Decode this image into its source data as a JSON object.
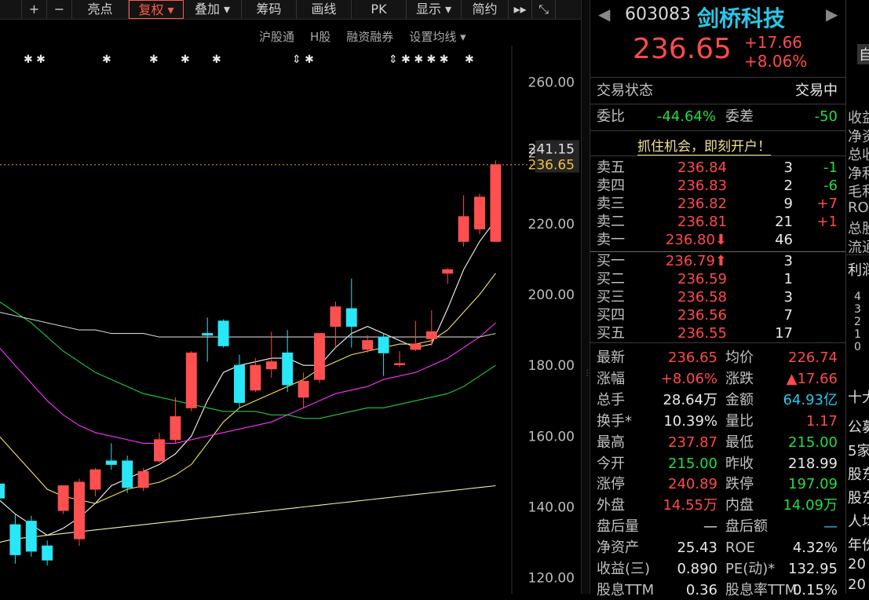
{
  "toolbar": {
    "items": [
      {
        "label": "",
        "w": 28
      },
      {
        "label": "+",
        "w": 32
      },
      {
        "label": "−",
        "w": 32
      },
      {
        "label": "亮点",
        "w": 72
      },
      {
        "label": "复权 ▾",
        "w": 70,
        "active": true
      },
      {
        "label": "叠加 ▾",
        "w": 74
      },
      {
        "label": "筹码",
        "w": 70
      },
      {
        "label": "画线",
        "w": 70
      },
      {
        "label": "PK",
        "w": 70
      },
      {
        "label": "显示 ▾",
        "w": 70
      },
      {
        "label": "简约",
        "w": 60
      },
      {
        "label": "▸▸",
        "w": 30
      },
      {
        "label": "⤡",
        "w": 30
      }
    ]
  },
  "subbar": [
    "沪股通",
    "H股",
    "融资融券",
    "设置均线 ▾"
  ],
  "chart_data": {
    "type": "candlestick",
    "ylim": [
      120,
      265
    ],
    "yticks": [
      "260.00",
      "240.00",
      "220.00",
      "200.00",
      "180.00",
      "160.00",
      "140.00",
      "120.00"
    ],
    "highlight_high": "241.15",
    "highlight_last": "236.65",
    "stars": [
      "✱ ✱",
      "✱",
      "✱",
      "✱",
      "✱",
      "⇕ ✱",
      "⇕ ✱ ✱ ✱ ✱",
      "✱"
    ],
    "candles": [
      {
        "o": 146.5,
        "h": 148.0,
        "c": 142.5,
        "l": 138.0
      },
      {
        "o": 135.0,
        "h": 138.0,
        "c": 126.5,
        "l": 124.0
      },
      {
        "o": 136.0,
        "h": 137.5,
        "c": 127.5,
        "l": 126.0
      },
      {
        "o": 129.0,
        "h": 130.5,
        "c": 125.0,
        "l": 123.5
      },
      {
        "o": 139.0,
        "h": 146.0,
        "c": 146.0,
        "l": 138.0
      },
      {
        "o": 131.0,
        "h": 148.0,
        "c": 147.0,
        "l": 129.0
      },
      {
        "o": 145.0,
        "h": 151.0,
        "c": 150.5,
        "l": 143.0
      },
      {
        "o": 153.0,
        "h": 158.0,
        "c": 152.0,
        "l": 150.5
      },
      {
        "o": 153.0,
        "h": 154.5,
        "c": 145.5,
        "l": 144.0
      },
      {
        "o": 145.5,
        "h": 151.0,
        "c": 150.0,
        "l": 144.5
      },
      {
        "o": 153.0,
        "h": 161.0,
        "c": 159.0,
        "l": 152.5
      },
      {
        "o": 159.0,
        "h": 171.0,
        "c": 165.5,
        "l": 158.0
      },
      {
        "o": 168.0,
        "h": 184.0,
        "c": 183.5,
        "l": 167.0
      },
      {
        "o": 189.0,
        "h": 193.5,
        "c": 188.5,
        "l": 181.0
      },
      {
        "o": 192.5,
        "h": 193.0,
        "c": 185.5,
        "l": 185.0
      },
      {
        "o": 180.0,
        "h": 183.0,
        "c": 169.5,
        "l": 168.0
      },
      {
        "o": 173.0,
        "h": 182.0,
        "c": 180.0,
        "l": 172.5
      },
      {
        "o": 179.0,
        "h": 189.5,
        "c": 181.0,
        "l": 176.5
      },
      {
        "o": 183.5,
        "h": 190.0,
        "c": 174.5,
        "l": 172.5
      },
      {
        "o": 171.0,
        "h": 178.0,
        "c": 175.5,
        "l": 168.0
      },
      {
        "o": 176.0,
        "h": 189.0,
        "c": 189.0,
        "l": 175.0
      },
      {
        "o": 191.0,
        "h": 198.0,
        "c": 196.5,
        "l": 185.0
      },
      {
        "o": 196.0,
        "h": 204.5,
        "c": 191.0,
        "l": 185.0
      },
      {
        "o": 184.5,
        "h": 188.5,
        "c": 187.0,
        "l": 183.5
      },
      {
        "o": 188.0,
        "h": 189.0,
        "c": 183.5,
        "l": 177.0
      },
      {
        "o": 180.5,
        "h": 184.0,
        "c": 180.5,
        "l": 179.5
      },
      {
        "o": 184.5,
        "h": 192.5,
        "c": 186.0,
        "l": 184.0
      },
      {
        "o": 187.5,
        "h": 195.5,
        "c": 189.5,
        "l": 185.5
      },
      {
        "o": 206.0,
        "h": 207.5,
        "c": 207.0,
        "l": 203.0
      },
      {
        "o": 215.0,
        "h": 228.0,
        "c": 222.0,
        "l": 213.5
      },
      {
        "o": 218.5,
        "h": 228.5,
        "c": 227.5,
        "l": 217.0
      },
      {
        "o": 215.0,
        "h": 237.87,
        "c": 236.65,
        "l": 215.0
      }
    ],
    "ma_lines": [
      {
        "name": "MA5",
        "color": "#f5f5f5",
        "values": [
          142,
          138,
          135,
          132,
          134,
          137,
          141,
          146,
          148,
          150,
          152,
          155,
          160,
          170,
          178,
          180,
          181,
          182,
          182,
          180,
          180,
          185,
          189,
          191,
          189,
          187,
          185,
          186,
          196,
          207,
          215,
          221
        ]
      },
      {
        "name": "MA10",
        "color": "#f2e85a",
        "values": [
          160,
          155,
          150,
          145,
          143,
          142,
          141,
          143,
          145,
          146,
          147,
          149,
          152,
          158,
          164,
          168,
          170,
          172,
          174,
          176,
          179,
          181,
          183,
          184,
          185,
          186,
          186,
          187,
          190,
          195,
          200,
          206
        ]
      },
      {
        "name": "MA20",
        "color": "#ff33ff",
        "values": [
          185,
          180,
          175,
          170,
          166,
          163,
          161,
          160,
          159,
          158,
          158,
          158,
          159,
          160,
          161,
          162,
          163,
          164,
          166,
          168,
          170,
          172,
          173,
          174,
          176,
          177,
          178,
          180,
          182,
          185,
          188,
          192
        ]
      },
      {
        "name": "MA30",
        "color": "#22cc44",
        "values": [
          198,
          195,
          192,
          188,
          184,
          181,
          178,
          176,
          174,
          172,
          171,
          170,
          169,
          168,
          167,
          167,
          167,
          166,
          166,
          165,
          165,
          166,
          167,
          168,
          168,
          169,
          170,
          171,
          172,
          174,
          177,
          180
        ]
      },
      {
        "name": "MA60",
        "color": "#cfcfcf",
        "values": [
          195,
          194,
          193,
          192,
          191,
          190,
          190,
          189,
          189,
          189,
          188,
          188,
          188,
          188,
          188,
          188,
          188,
          188,
          188,
          188,
          188,
          188,
          188,
          188,
          188,
          188,
          188,
          188,
          188,
          188,
          188,
          189
        ]
      },
      {
        "name": "MA120",
        "color": "#f5f0a8",
        "values": [
          130,
          131,
          131.5,
          132,
          132.5,
          133,
          133.5,
          134,
          134.5,
          135,
          135.5,
          136,
          136.5,
          137,
          137.5,
          138,
          138.5,
          139,
          139.5,
          140,
          140.5,
          141,
          141.5,
          142,
          142.5,
          143,
          143.5,
          144,
          144.5,
          145,
          145.5,
          146
        ]
      }
    ]
  },
  "quote": {
    "code": "603083",
    "name": "剑桥科技",
    "price": "236.65",
    "change": "+17.66",
    "change_pct": "+8.06%"
  },
  "status": {
    "label": "交易状态",
    "value": "交易中"
  },
  "ratio": {
    "label1": "委比",
    "val1": "-44.64%",
    "label2": "委差",
    "val2": "-50"
  },
  "promo": "抓住机会，即刻开户！",
  "asks": [
    {
      "name": "卖五",
      "price": "236.84",
      "vol": "3",
      "chg": "-1",
      "chgcls": "c-green"
    },
    {
      "name": "卖四",
      "price": "236.83",
      "vol": "2",
      "chg": "-6",
      "chgcls": "c-green"
    },
    {
      "name": "卖三",
      "price": "236.82",
      "vol": "9",
      "chg": "+7",
      "chgcls": "c-red"
    },
    {
      "name": "卖二",
      "price": "236.81",
      "vol": "21",
      "chg": "+1",
      "chgcls": "c-red"
    },
    {
      "name": "卖一",
      "price": "236.80⬇",
      "vol": "46",
      "chg": "",
      "chgcls": "c-red"
    }
  ],
  "bids": [
    {
      "name": "买一",
      "price": "236.79⬆",
      "vol": "3"
    },
    {
      "name": "买二",
      "price": "236.59",
      "vol": "1"
    },
    {
      "name": "买三",
      "price": "236.58",
      "vol": "3"
    },
    {
      "name": "买四",
      "price": "236.56",
      "vol": "7"
    },
    {
      "name": "买五",
      "price": "236.55",
      "vol": "17"
    }
  ],
  "stats": [
    {
      "l1": "最新",
      "v1": "236.65",
      "c1": "c-red",
      "l2": "均价",
      "v2": "226.74",
      "c2": "c-red"
    },
    {
      "l1": "涨幅",
      "v1": "+8.06%",
      "c1": "c-red",
      "l2": "涨跌",
      "v2": "▲17.66",
      "c2": "c-red"
    },
    {
      "l1": "总手",
      "v1": "28.64万",
      "c1": "c-white",
      "l2": "金额",
      "v2": "64.93亿",
      "c2": "c-cyan"
    },
    {
      "l1": "换手*",
      "v1": "10.39%",
      "c1": "c-white",
      "l2": "量比",
      "v2": "1.17",
      "c2": "c-red"
    },
    {
      "l1": "最高",
      "v1": "237.87",
      "c1": "c-red",
      "l2": "最低",
      "v2": "215.00",
      "c2": "c-green"
    },
    {
      "l1": "今开",
      "v1": "215.00",
      "c1": "c-green",
      "l2": "昨收",
      "v2": "218.99",
      "c2": "c-white"
    },
    {
      "l1": "涨停",
      "v1": "240.89",
      "c1": "c-red",
      "l2": "跌停",
      "v2": "197.09",
      "c2": "c-green"
    },
    {
      "l1": "外盘",
      "v1": "14.55万",
      "c1": "c-red",
      "l2": "内盘",
      "v2": "14.09万",
      "c2": "c-green"
    },
    {
      "l1": "盘后量",
      "v1": "—",
      "c1": "c-white",
      "l2": "盘后额",
      "v2": "—",
      "c2": "c-cyan"
    },
    {
      "l1": "净资产",
      "v1": "25.43",
      "c1": "c-white",
      "l2": "ROE",
      "v2": "4.32%",
      "c2": "c-white"
    },
    {
      "l1": "收益(三)",
      "v1": "0.890",
      "c1": "c-white",
      "l2": "PE(动)*",
      "v2": "132.95",
      "c2": "c-white"
    },
    {
      "l1": "股息TTM",
      "v1": "0.36",
      "c1": "c-white",
      "l2": "股息率TTM",
      "v2": "0.15%",
      "c2": "c-white"
    }
  ],
  "right_strip": {
    "top": [
      "自"
    ],
    "items": [
      "收益",
      "净资",
      "总收",
      "净利",
      "毛利",
      "RO",
      "总股",
      "流通"
    ],
    "section": "利润",
    "nums": [
      "4",
      "3",
      "2",
      "1",
      "0"
    ],
    "tail": [
      "十大",
      "公募",
      "5家",
      "股东",
      "股东",
      "人均",
      "年份",
      "20",
      "20"
    ]
  }
}
